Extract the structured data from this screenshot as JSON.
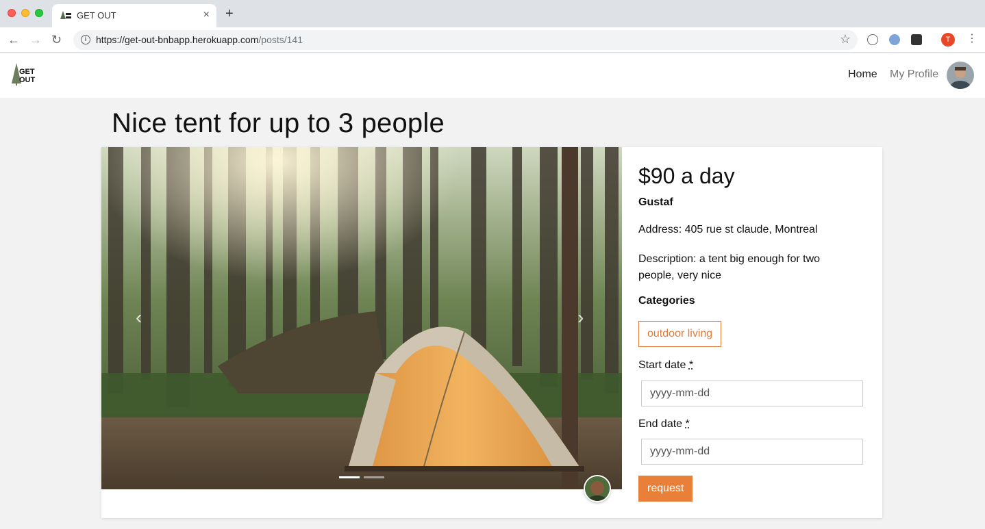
{
  "browser": {
    "tab_title": "GET OUT",
    "tab_close": "×",
    "new_tab": "+",
    "url_host": "https://get-out-bnbapp.herokuapp.com",
    "url_path": "/posts/141",
    "profile_initial": "T"
  },
  "header": {
    "logo_text_1": "GET",
    "logo_text_2": "OUT",
    "nav_home": "Home",
    "nav_profile": "My Profile"
  },
  "post": {
    "title": "Nice tent for up to 3 people",
    "price": "$90 a day",
    "owner": "Gustaf",
    "address": "Address: 405 rue st claude, Montreal",
    "description": "Description: a tent big enough for two people, very nice",
    "categories_label": "Categories",
    "categories": [
      "outdoor living"
    ]
  },
  "carousel": {
    "prev_label": "‹",
    "next_label": "›",
    "slide_count": 2,
    "active_slide": 1
  },
  "booking": {
    "start_label": "Start date",
    "end_label": "End date",
    "required_mark": "*",
    "start_placeholder": "yyyy-mm-dd",
    "end_placeholder": "yyyy-mm-dd",
    "submit_label": "request"
  },
  "colors": {
    "accent": "#e8803a",
    "tag_border": "#e07b3a"
  }
}
